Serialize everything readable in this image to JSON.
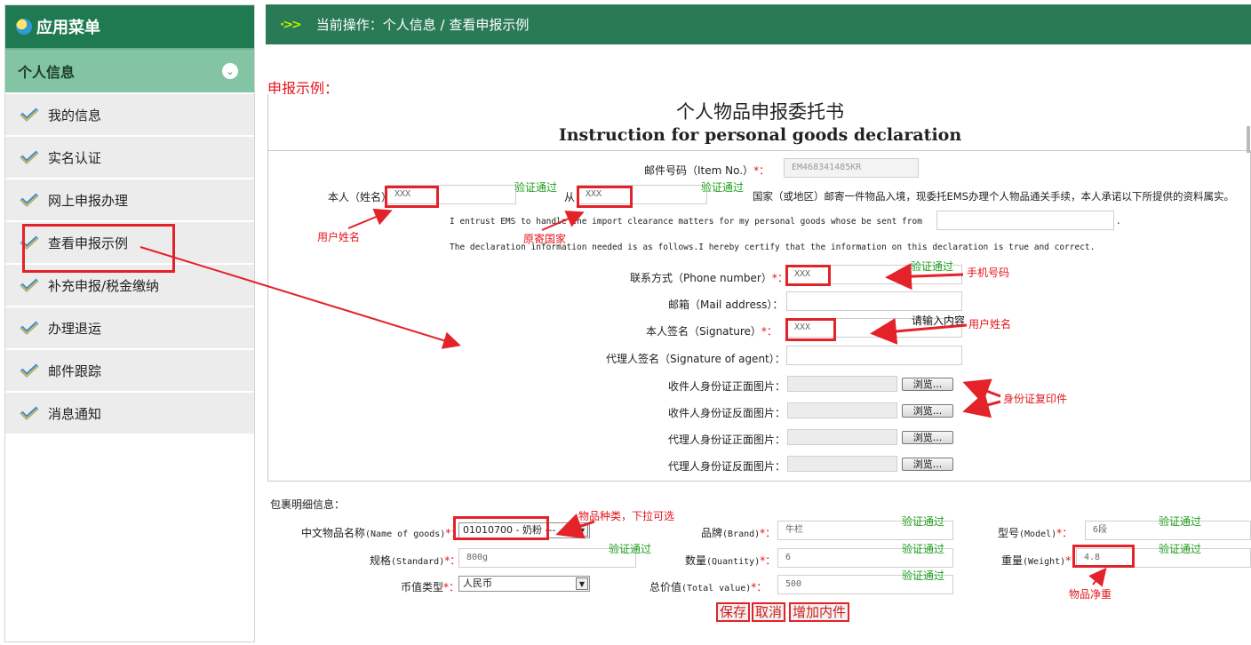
{
  "sidebar": {
    "title": "应用菜单",
    "section": "个人信息",
    "items": [
      {
        "label": "我的信息"
      },
      {
        "label": "实名认证"
      },
      {
        "label": "网上申报办理"
      },
      {
        "label": "查看申报示例"
      },
      {
        "label": "补充申报/税金缴纳"
      },
      {
        "label": "办理退运"
      },
      {
        "label": "邮件跟踪"
      },
      {
        "label": "消息通知"
      }
    ]
  },
  "topbar": {
    "arrow": "·>>",
    "breadcrumb": "当前操作：个人信息 / 查看申报示例"
  },
  "page": {
    "sample_title": "申报示例："
  },
  "form": {
    "title_cn": "个人物品申报委托书",
    "title_en": "Instruction for personal goods declaration",
    "item_no_label": "邮件号码（Item No.）",
    "item_no_value": "EM468341485KR",
    "me_label": "本人（姓名）",
    "name_value": "XXX",
    "from_label": "从",
    "country_value": "XXX",
    "statement_cn": "国家（或地区）邮寄一件物品入境，现委托EMS办理个人物品通关手续，本人承诺以下所提供的资料属实。",
    "entrust_en": "I entrust EMS to handle the import clearance matters for my personal goods whose be sent from",
    "entrust_en_end": ".",
    "declare_en": "The declaration information needed is as follows.I hereby certify that the information on this declaration is true and correct.",
    "phone_label": "联系方式（Phone number）",
    "phone_value": "XXX",
    "mail_label": "邮箱（Mail address）：",
    "sign_label": "本人签名（Signature）",
    "sign_value": "XXX",
    "sign_hint": "请输入内容",
    "agent_label": "代理人签名（Signature of agent）：",
    "id_front_label": "收件人身份证正面图片：",
    "id_back_label": "收件人身份证反面图片：",
    "agent_front_label": "代理人身份证正面图片：",
    "agent_back_label": "代理人身份证反面图片：",
    "browse_label": "浏览..."
  },
  "verified": "验证通过",
  "required_mark": "*：",
  "annotations": {
    "user_name": "用户姓名",
    "origin_country": "原寄国家",
    "phone": "手机号码",
    "user_name2": "用户姓名",
    "id_copy": "身份证复印件",
    "goods_type": "物品种类，下拉可选",
    "net_weight": "物品净重"
  },
  "package": {
    "header": "包裹明细信息：",
    "goods_name_label": "中文物品名称",
    "goods_name_en": "(Name of goods)",
    "goods_name_value": "01010700 - 奶粉",
    "goods_name_suffix": "---",
    "brand_label": "品牌",
    "brand_en": "(Brand)",
    "brand_value": "牛栏",
    "model_label": "型号",
    "model_en": "(Model)",
    "model_value": "6段",
    "standard_label": "规格",
    "standard_en": "(Standard)",
    "standard_value": "800g",
    "quantity_label": "数量",
    "quantity_en": "(Quantity)",
    "quantity_value": "6",
    "weight_label": "重量",
    "weight_en": "(Weight)",
    "weight_value": "4.8",
    "currency_label": "币值类型",
    "currency_value": "人民币",
    "total_label": "总价值",
    "total_en": "(Total value)",
    "total_value": "500",
    "save": "保存",
    "cancel": "取消",
    "add_item": "增加内件"
  },
  "colors": {
    "header_green": "#1f7a52",
    "section_green": "#82c4a3",
    "annotation_red": "#e32229",
    "verified_green": "#1e9e1e"
  }
}
